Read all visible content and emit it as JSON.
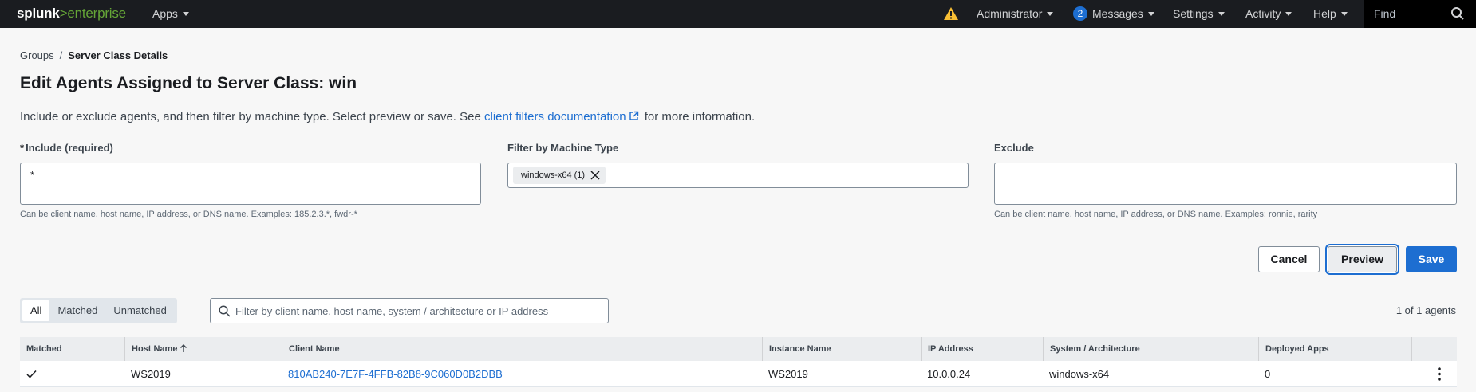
{
  "nav": {
    "logo_brand": "splunk",
    "logo_gt": ">",
    "logo_product": "enterprise",
    "apps": "Apps",
    "user": "Administrator",
    "messages_count": "2",
    "messages": "Messages",
    "settings": "Settings",
    "activity": "Activity",
    "help": "Help",
    "find_placeholder": "Find"
  },
  "breadcrumb": {
    "groups": "Groups",
    "separator": "/",
    "current": "Server Class Details"
  },
  "page": {
    "title": "Edit Agents Assigned to Server Class: win",
    "intro_before": "Include or exclude agents, and then filter by machine type. Select preview or save. See ",
    "intro_link": "client filters documentation",
    "intro_after": " for more information."
  },
  "form": {
    "include": {
      "required_mark": "*",
      "label": "Include (required)",
      "value": "*",
      "help": "Can be client name, host name, IP address, or DNS name. Examples: 185.2.3.*, fwdr-*"
    },
    "machine_type": {
      "label": "Filter by Machine Type",
      "chips": [
        "windows-x64 (1)"
      ]
    },
    "exclude": {
      "label": "Exclude",
      "value": "",
      "help": "Can be client name, host name, IP address, or DNS name. Examples: ronnie, rarity"
    }
  },
  "actions": {
    "cancel": "Cancel",
    "preview": "Preview",
    "save": "Save"
  },
  "filter": {
    "tabs": [
      "All",
      "Matched",
      "Unmatched"
    ],
    "selected_tab": "All",
    "search_placeholder": "Filter by client name, host name, system / architecture or IP address",
    "count": "1 of 1 agents"
  },
  "table": {
    "columns": [
      "Matched",
      "Host Name",
      "Client Name",
      "Instance Name",
      "IP Address",
      "System / Architecture",
      "Deployed Apps"
    ],
    "sorted_column": "Host Name",
    "sort_direction": "ascending",
    "rows": [
      {
        "matched": true,
        "host": "WS2019",
        "client": "810AB240-7E7F-4FFB-82B8-9C060D0B2DBB",
        "instance": "WS2019",
        "ip": "10.0.0.24",
        "system": "windows-x64",
        "apps": "0"
      }
    ]
  },
  "colors": {
    "nav_bg": "#1a1c20",
    "brand_green": "#65a637",
    "accent_blue": "#1d6ed1",
    "warning_yellow": "#f8be34"
  }
}
